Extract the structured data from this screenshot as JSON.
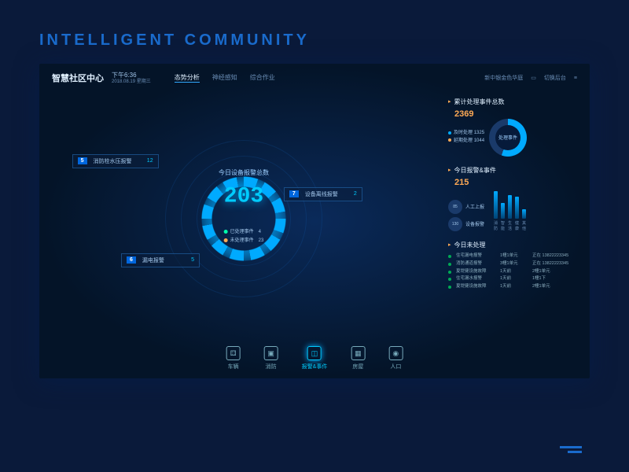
{
  "title": "INTELLIGENT  COMMUNITY",
  "header": {
    "logo": "智慧社区中心",
    "time": "下午6:36",
    "date": "2018.08.19 星期三",
    "nav": [
      "态势分析",
      "神经感知",
      "综合作业"
    ],
    "right": {
      "location": "新中银金色华庭",
      "switch": "切换后台"
    }
  },
  "center": {
    "title": "今日设备报警总数",
    "big_number": "203",
    "processed": {
      "label": "已处理事件",
      "value": "4"
    },
    "unprocessed": {
      "label": "未处理事件",
      "value": "23"
    },
    "callouts": [
      {
        "badge": "5",
        "label": "消防栓水压报警",
        "value": "12"
      },
      {
        "badge": "7",
        "label": "设备离线报警",
        "value": "2"
      },
      {
        "badge": "6",
        "label": "漏电报警",
        "value": "5"
      }
    ]
  },
  "right": {
    "total": {
      "title": "累计处理事件总数",
      "value": "2369",
      "legend": [
        {
          "c": "#0af",
          "t": "及时处理",
          "v": "1325"
        },
        {
          "c": "#fa5",
          "t": "延期处理",
          "v": "1044"
        }
      ],
      "donut_label": "处理事件"
    },
    "today": {
      "title": "今日报警&事件",
      "value": "215",
      "pies": [
        {
          "v": "85",
          "t": "人工上报"
        },
        {
          "v": "130",
          "t": "设备报警"
        }
      ]
    },
    "pending": {
      "title": "今日未处理",
      "rows": [
        {
          "a": "住宅漏电报警",
          "b": "1幢1单元",
          "c": "正在 13822223345"
        },
        {
          "a": "消防通道报警",
          "b": "3幢1单元",
          "c": "正在 13822223345"
        },
        {
          "a": "夏堤健设施故障",
          "b": "1天前",
          "c": "2幢1单元"
        },
        {
          "a": "住宅漏水报警",
          "b": "1天前",
          "c": "1幢1下"
        },
        {
          "a": "夏堤健设施故障",
          "b": "1天前",
          "c": "2幢1单元"
        }
      ]
    }
  },
  "chart_data": {
    "type": "bar",
    "categories": [
      "消防",
      "智能",
      "生活",
      "健康",
      "其他"
    ],
    "values": [
      35,
      20,
      30,
      28,
      12
    ],
    "ylim": [
      0,
      40
    ]
  },
  "bottom_nav": [
    "车辆",
    "消防",
    "报警&事件",
    "房屋",
    "人口"
  ]
}
